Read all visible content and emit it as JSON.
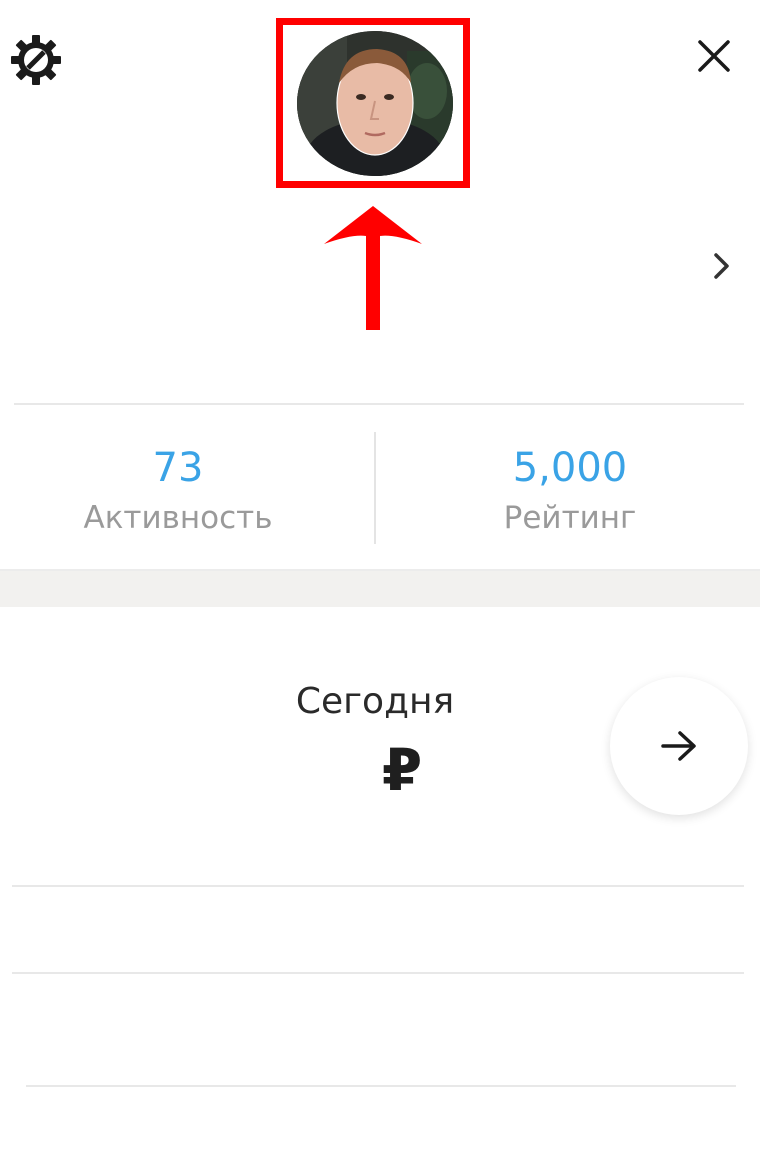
{
  "header": {
    "settings_icon": "gear-icon",
    "close_icon": "close-icon",
    "avatar_icon": "avatar-photo",
    "highlight_color": "#ff0000",
    "profile_chevron_icon": "chevron-right-icon"
  },
  "stats": {
    "activity": {
      "value": "73",
      "label": "Активность"
    },
    "rating": {
      "value": "5,000",
      "label": "Рейтинг"
    },
    "value_color": "#3aa3e6"
  },
  "today": {
    "title": "Сегодня",
    "currency_symbol": "₽",
    "next_icon": "arrow-right-icon"
  }
}
